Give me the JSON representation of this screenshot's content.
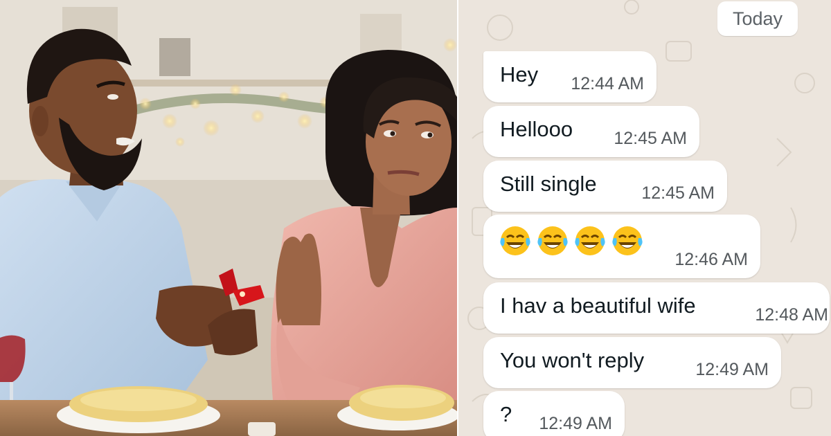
{
  "chat": {
    "date_chip": "Today",
    "messages": [
      {
        "text": "Hey",
        "time": "12:44 AM"
      },
      {
        "text": "Hellooo",
        "time": "12:45 AM"
      },
      {
        "text": "Still single",
        "time": "12:45 AM"
      },
      {
        "emoji": [
          "face-with-tears-of-joy-icon",
          "face-with-tears-of-joy-icon",
          "face-with-tears-of-joy-icon",
          "face-with-tears-of-joy-icon"
        ],
        "time": "12:46 AM"
      },
      {
        "text": "I hav a beautiful wife",
        "time": "12:48 AM"
      },
      {
        "text": "You won't reply",
        "time": "12:49 AM"
      },
      {
        "text": "?",
        "time": "12:49 AM"
      }
    ]
  },
  "colors": {
    "chat_background": "#ece5dd",
    "bubble": "#ffffff",
    "shirt_blue": "#bcd3ea",
    "dress_pink": "#e9a89f",
    "ring_box_red": "#d7161b"
  }
}
